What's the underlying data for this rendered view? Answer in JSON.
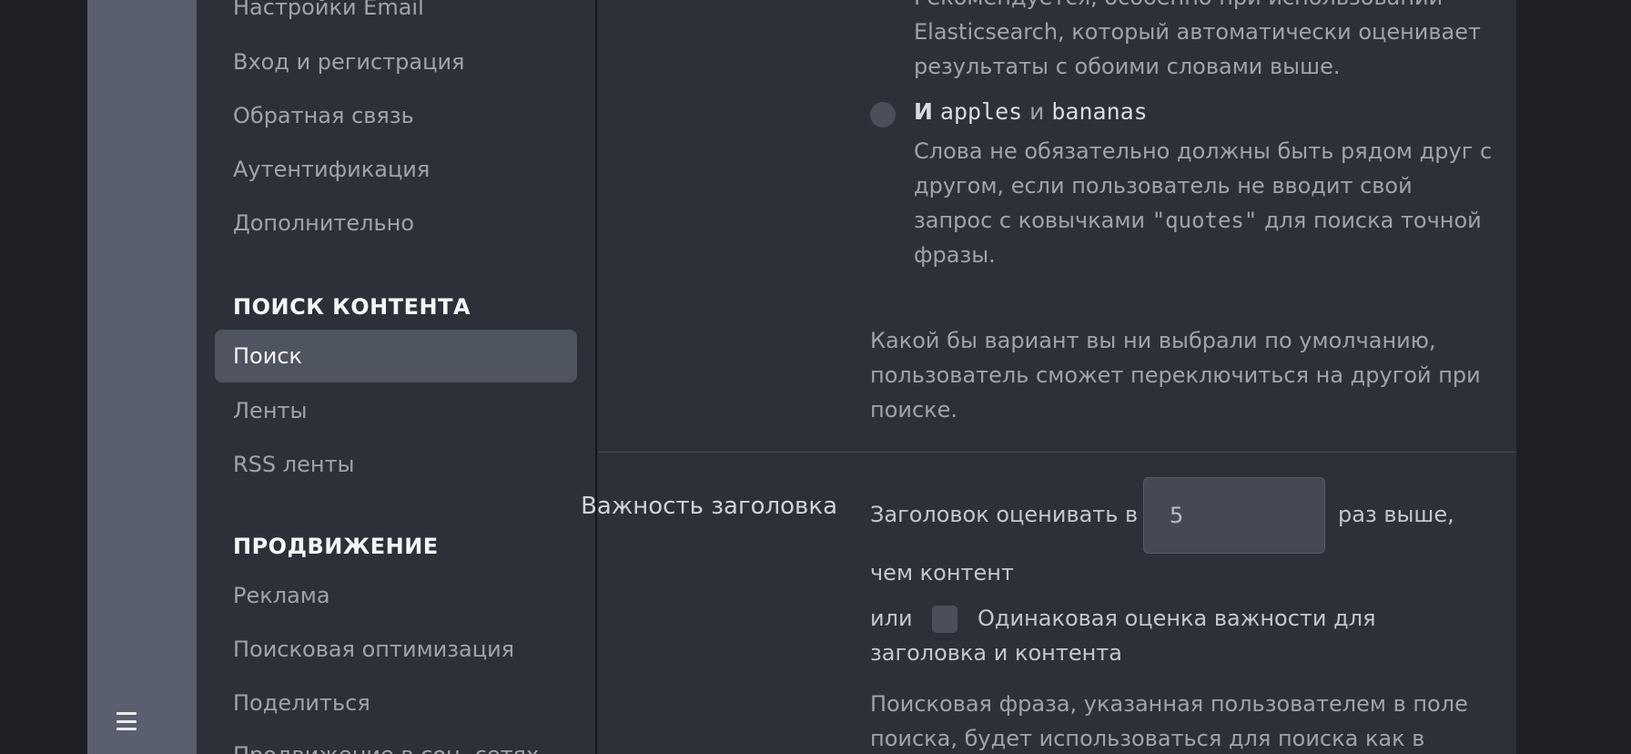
{
  "rail": {
    "menu_icon": "hamburger-menu-icon"
  },
  "sidebar": {
    "items_top": [
      "Настройки Email",
      "Вход и регистрация",
      "Обратная связь",
      "Аутентификация",
      "Дополнительно"
    ],
    "section_search": "ПОИСК КОНТЕНТА",
    "search_items": [
      "Поиск",
      "Ленты",
      "RSS ленты"
    ],
    "active_item": "Поиск",
    "section_promo": "ПРОДВИЖЕНИЕ",
    "promo_items": [
      "Реклама",
      "Поисковая оптимизация",
      "Поделиться",
      "Продвижение в соц. сетях"
    ]
  },
  "main": {
    "recommend_lines": [
      "Рекомендуется, особенно при использовании",
      "Elasticsearch, который автоматически оценивает",
      "результаты с обоими словами выше."
    ],
    "and_option": {
      "bold": "И",
      "word1": "apples",
      "conj": "и",
      "word2": "bananas"
    },
    "and_desc": {
      "line1": "Слова не обязательно должны быть рядом друг с",
      "line2": "другом, если пользователь не вводит свой",
      "line3_pre": "запрос с ковычками ",
      "line3_code": "\"quotes\"",
      "line3_post": " для поиска точной",
      "line4": "фразы."
    },
    "switch_note": [
      "Какой бы вариант вы ни выбрали по умолчанию,",
      "пользователь сможет переключиться на другой при",
      "поиске."
    ],
    "title_importance_label": "Важность заголовка",
    "title_weight": {
      "prefix": "Заголовок оценивать в",
      "value": "5",
      "suffix": "раз выше,",
      "line2": "чем контент"
    },
    "equal_option": {
      "or": "или",
      "line1": "Одинаковая оценка важности для",
      "line2": "заголовка и контента"
    },
    "search_phrase_note": [
      "Поисковая фраза, указанная пользователем в поле",
      "поиска, будет использоваться для поиска как в"
    ]
  },
  "colors": {
    "background": "#2e3039",
    "rail": "#595f6e",
    "active_item": "#4f5461",
    "muted_text": "#9ea3ad",
    "heading_text": "#f4f5f7"
  }
}
